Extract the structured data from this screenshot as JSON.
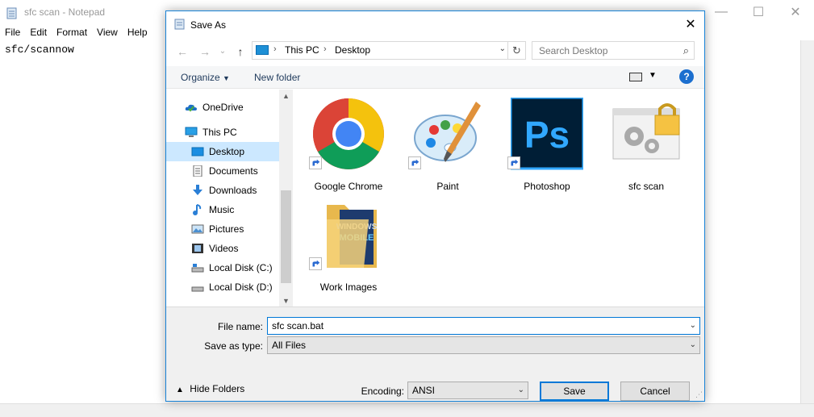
{
  "notepad": {
    "title": "sfc scan - Notepad",
    "menu": [
      "File",
      "Edit",
      "Format",
      "View",
      "Help"
    ],
    "content": "sfc/scannow"
  },
  "dialog": {
    "title": "Save As",
    "address": {
      "crumbs": [
        "This PC",
        "Desktop"
      ]
    },
    "search_placeholder": "Search Desktop",
    "toolbar": {
      "organize": "Organize",
      "new_folder": "New folder"
    },
    "nav_items": [
      {
        "label": "OneDrive",
        "icon": "onedrive-icon"
      },
      {
        "label": "This PC",
        "icon": "pc-icon"
      },
      {
        "label": "Desktop",
        "icon": "desktop-icon",
        "selected": true
      },
      {
        "label": "Documents",
        "icon": "documents-icon"
      },
      {
        "label": "Downloads",
        "icon": "downloads-icon"
      },
      {
        "label": "Music",
        "icon": "music-icon"
      },
      {
        "label": "Pictures",
        "icon": "pictures-icon"
      },
      {
        "label": "Videos",
        "icon": "videos-icon"
      },
      {
        "label": "Local Disk (C:)",
        "icon": "drive-icon"
      },
      {
        "label": "Local Disk (D:)",
        "icon": "drive-icon"
      }
    ],
    "files": [
      {
        "label": "Google Chrome",
        "icon": "chrome-icon",
        "shortcut": true
      },
      {
        "label": "Paint",
        "icon": "paint-icon",
        "shortcut": true
      },
      {
        "label": "Photoshop",
        "icon": "photoshop-icon",
        "shortcut": true
      },
      {
        "label": "sfc scan",
        "icon": "batch-file-icon",
        "shortcut": false
      },
      {
        "label": "Work Images",
        "icon": "folder-icon",
        "shortcut": true
      }
    ],
    "file_name_label": "File name:",
    "file_name_value": "sfc scan.bat",
    "save_type_label": "Save as type:",
    "save_type_value": "All Files",
    "hide_folders": "Hide Folders",
    "encoding_label": "Encoding:",
    "encoding_value": "ANSI",
    "save_button": "Save",
    "cancel_button": "Cancel"
  },
  "colors": {
    "accent": "#0078d7",
    "selected_nav": "#cce8ff",
    "photoshop_bg": "#001e36",
    "photoshop_text": "#31a8ff"
  }
}
